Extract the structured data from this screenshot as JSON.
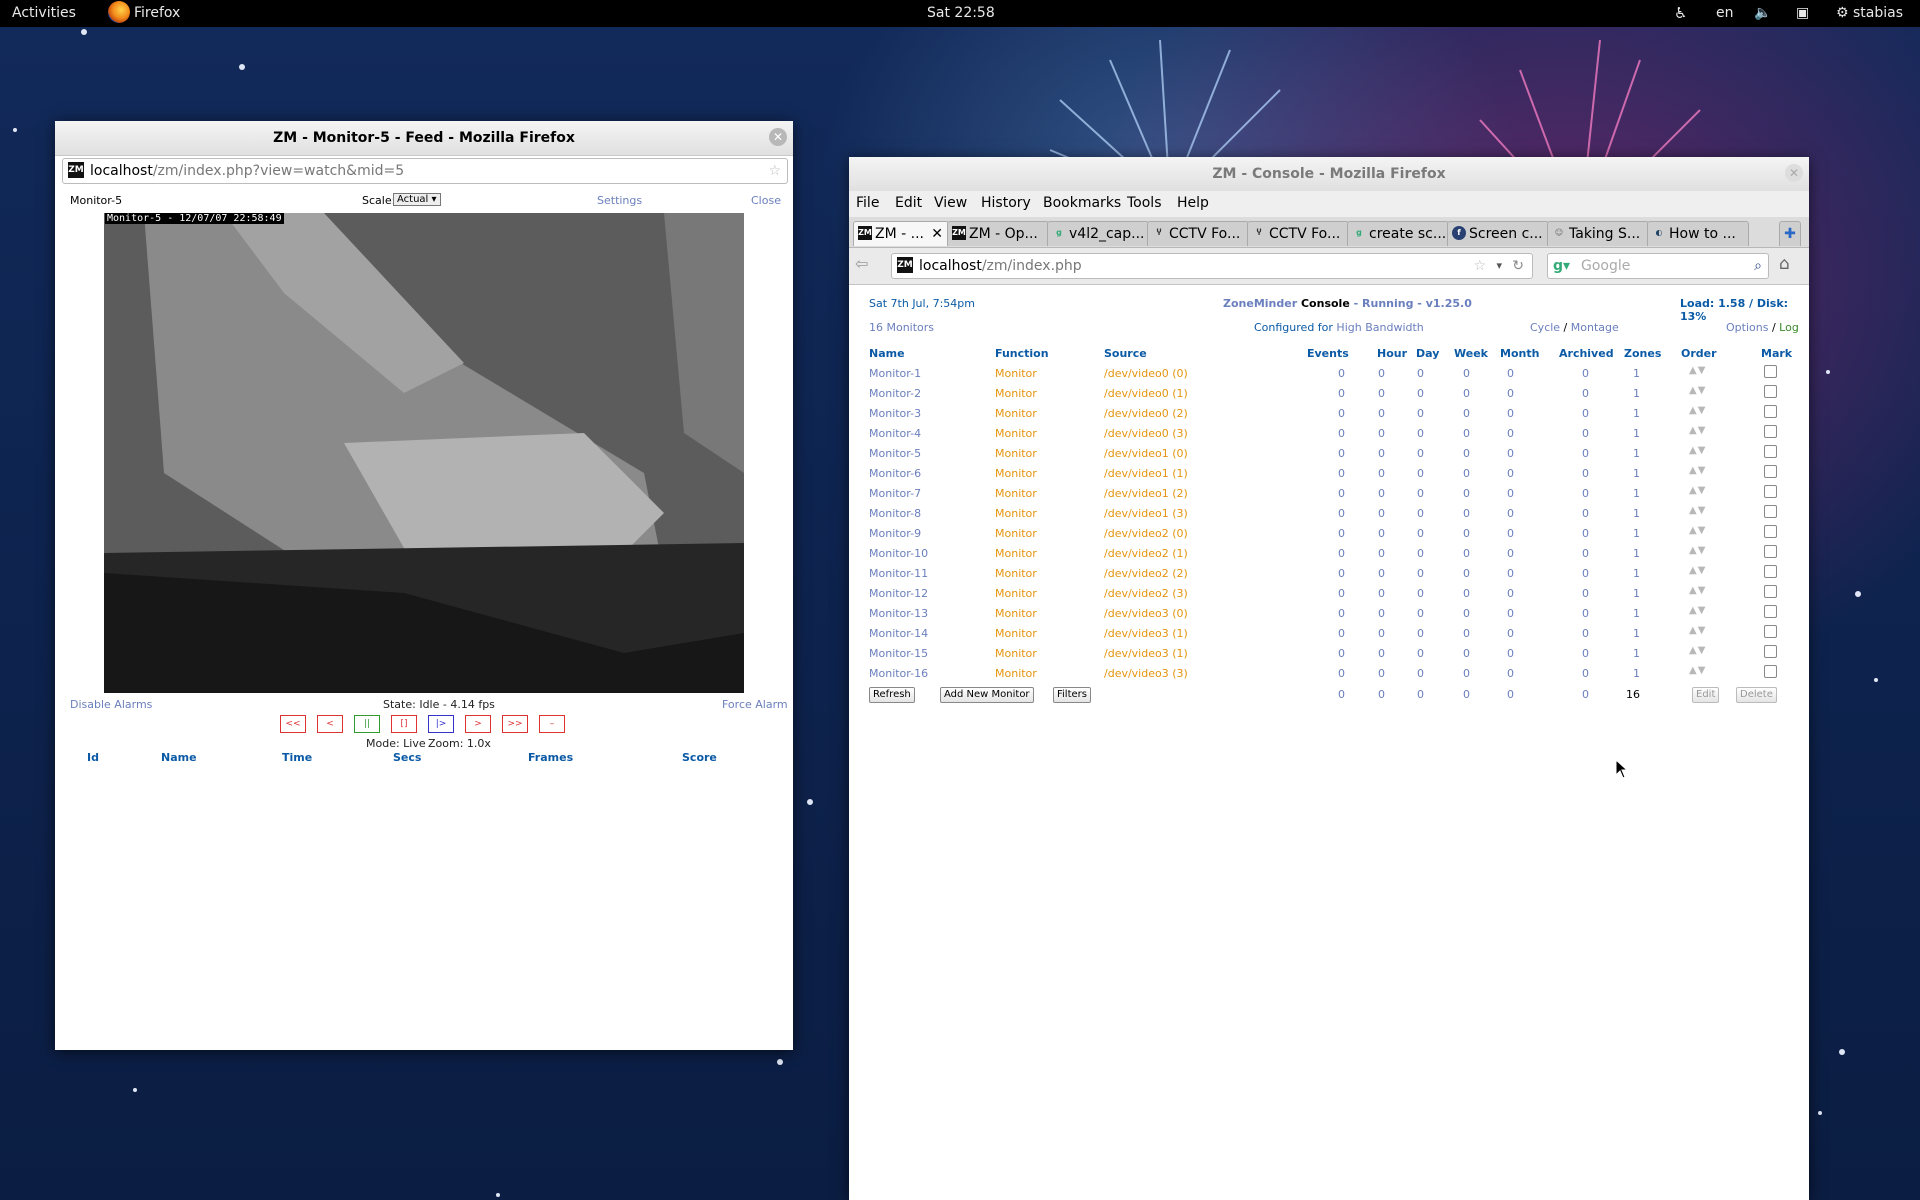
{
  "topbar": {
    "activities": "Activities",
    "app_name": "Firefox",
    "clock": "Sat 22:58",
    "lang": "en",
    "user": "stabias"
  },
  "feed_window": {
    "title": "ZM - Monitor-5 - Feed - Mozilla Firefox",
    "url_host": "localhost",
    "url_rest": "/zm/index.php?view=watch&mid=5",
    "monitor_name": "Monitor-5",
    "scale_label": "Scale:",
    "scale_value": "Actual",
    "settings_link": "Settings",
    "close_link": "Close",
    "overlay_text": "Monitor-5 - 12/07/07 22:58:49",
    "disable_alarms": "Disable Alarms",
    "state_text": "State: Idle - 4.14 fps",
    "force_alarm": "Force Alarm",
    "controls": [
      "<<",
      "<",
      "||",
      "[]",
      "|>",
      ">",
      ">>",
      "–"
    ],
    "mode_text": "Mode: Live",
    "zoom_text": "Zoom: 1.0x",
    "event_columns": [
      "Id",
      "Name",
      "Time",
      "Secs",
      "Frames",
      "Score"
    ]
  },
  "console_window": {
    "title": "ZM - Console - Mozilla Firefox",
    "menu": [
      "File",
      "Edit",
      "View",
      "History",
      "Bookmarks",
      "Tools",
      "Help"
    ],
    "tabs": [
      {
        "label": "ZM - ...",
        "icon": "zm-icon"
      },
      {
        "label": "ZM - Op...",
        "icon": "zm-icon"
      },
      {
        "label": "v4l2_cap...",
        "icon": "google-icon"
      },
      {
        "label": "CCTV Fo...",
        "icon": "forum-icon"
      },
      {
        "label": "CCTV Fo...",
        "icon": "forum-icon"
      },
      {
        "label": "create sc...",
        "icon": "google-icon"
      },
      {
        "label": "Screen c...",
        "icon": "fedora-icon"
      },
      {
        "label": "Taking S...",
        "icon": "page-icon"
      },
      {
        "label": "How to ...",
        "icon": "page-icon"
      }
    ],
    "url_host": "localhost",
    "url_rest": "/zm/index.php",
    "search_placeholder": "Google",
    "date": "Sat 7th Jul, 7:54pm",
    "header_zm": "ZoneMinder",
    "header_console": "Console",
    "header_sep1": " - ",
    "header_running": "Running",
    "header_sep2": " - ",
    "header_version": "v1.25.0",
    "load": "Load: 1.58 / Disk: 13%",
    "monitor_count": "16 Monitors",
    "configured_for": "Configured for",
    "bandwidth": "High",
    "bandwidth_word": "Bandwidth",
    "cycle": "Cycle",
    "slash1": " / ",
    "montage": "Montage",
    "options": "Options",
    "slash2": " / ",
    "log": "Log",
    "columns": [
      "Name",
      "Function",
      "Source",
      "Events",
      "Hour",
      "Day",
      "Week",
      "Month",
      "Archived",
      "Zones",
      "Order",
      "Mark"
    ],
    "monitors": [
      {
        "name": "Monitor-1",
        "function": "Monitor",
        "source": "/dev/video0 (0)",
        "events": "0",
        "hour": "0",
        "day": "0",
        "week": "0",
        "month": "0",
        "archived": "0",
        "zones": "1"
      },
      {
        "name": "Monitor-2",
        "function": "Monitor",
        "source": "/dev/video0 (1)",
        "events": "0",
        "hour": "0",
        "day": "0",
        "week": "0",
        "month": "0",
        "archived": "0",
        "zones": "1"
      },
      {
        "name": "Monitor-3",
        "function": "Monitor",
        "source": "/dev/video0 (2)",
        "events": "0",
        "hour": "0",
        "day": "0",
        "week": "0",
        "month": "0",
        "archived": "0",
        "zones": "1"
      },
      {
        "name": "Monitor-4",
        "function": "Monitor",
        "source": "/dev/video0 (3)",
        "events": "0",
        "hour": "0",
        "day": "0",
        "week": "0",
        "month": "0",
        "archived": "0",
        "zones": "1"
      },
      {
        "name": "Monitor-5",
        "function": "Monitor",
        "source": "/dev/video1 (0)",
        "events": "0",
        "hour": "0",
        "day": "0",
        "week": "0",
        "month": "0",
        "archived": "0",
        "zones": "1"
      },
      {
        "name": "Monitor-6",
        "function": "Monitor",
        "source": "/dev/video1 (1)",
        "events": "0",
        "hour": "0",
        "day": "0",
        "week": "0",
        "month": "0",
        "archived": "0",
        "zones": "1"
      },
      {
        "name": "Monitor-7",
        "function": "Monitor",
        "source": "/dev/video1 (2)",
        "events": "0",
        "hour": "0",
        "day": "0",
        "week": "0",
        "month": "0",
        "archived": "0",
        "zones": "1"
      },
      {
        "name": "Monitor-8",
        "function": "Monitor",
        "source": "/dev/video1 (3)",
        "events": "0",
        "hour": "0",
        "day": "0",
        "week": "0",
        "month": "0",
        "archived": "0",
        "zones": "1"
      },
      {
        "name": "Monitor-9",
        "function": "Monitor",
        "source": "/dev/video2 (0)",
        "events": "0",
        "hour": "0",
        "day": "0",
        "week": "0",
        "month": "0",
        "archived": "0",
        "zones": "1"
      },
      {
        "name": "Monitor-10",
        "function": "Monitor",
        "source": "/dev/video2 (1)",
        "events": "0",
        "hour": "0",
        "day": "0",
        "week": "0",
        "month": "0",
        "archived": "0",
        "zones": "1"
      },
      {
        "name": "Monitor-11",
        "function": "Monitor",
        "source": "/dev/video2 (2)",
        "events": "0",
        "hour": "0",
        "day": "0",
        "week": "0",
        "month": "0",
        "archived": "0",
        "zones": "1"
      },
      {
        "name": "Monitor-12",
        "function": "Monitor",
        "source": "/dev/video2 (3)",
        "events": "0",
        "hour": "0",
        "day": "0",
        "week": "0",
        "month": "0",
        "archived": "0",
        "zones": "1"
      },
      {
        "name": "Monitor-13",
        "function": "Monitor",
        "source": "/dev/video3 (0)",
        "events": "0",
        "hour": "0",
        "day": "0",
        "week": "0",
        "month": "0",
        "archived": "0",
        "zones": "1"
      },
      {
        "name": "Monitor-14",
        "function": "Monitor",
        "source": "/dev/video3 (1)",
        "events": "0",
        "hour": "0",
        "day": "0",
        "week": "0",
        "month": "0",
        "archived": "0",
        "zones": "1"
      },
      {
        "name": "Monitor-15",
        "function": "Monitor",
        "source": "/dev/video3 (1)",
        "events": "0",
        "hour": "0",
        "day": "0",
        "week": "0",
        "month": "0",
        "archived": "0",
        "zones": "1"
      },
      {
        "name": "Monitor-16",
        "function": "Monitor",
        "source": "/dev/video3 (3)",
        "events": "0",
        "hour": "0",
        "day": "0",
        "week": "0",
        "month": "0",
        "archived": "0",
        "zones": "1"
      }
    ],
    "totals": {
      "events": "0",
      "hour": "0",
      "day": "0",
      "week": "0",
      "month": "0",
      "archived": "0",
      "zones": "16"
    },
    "buttons": {
      "refresh": "Refresh",
      "add": "Add New Monitor",
      "filters": "Filters",
      "edit": "Edit",
      "delete": "Delete"
    }
  },
  "colors": {
    "zm_blue": "#0b5aa6",
    "zm_orange": "#e59410",
    "link": "#6a7fbd"
  }
}
